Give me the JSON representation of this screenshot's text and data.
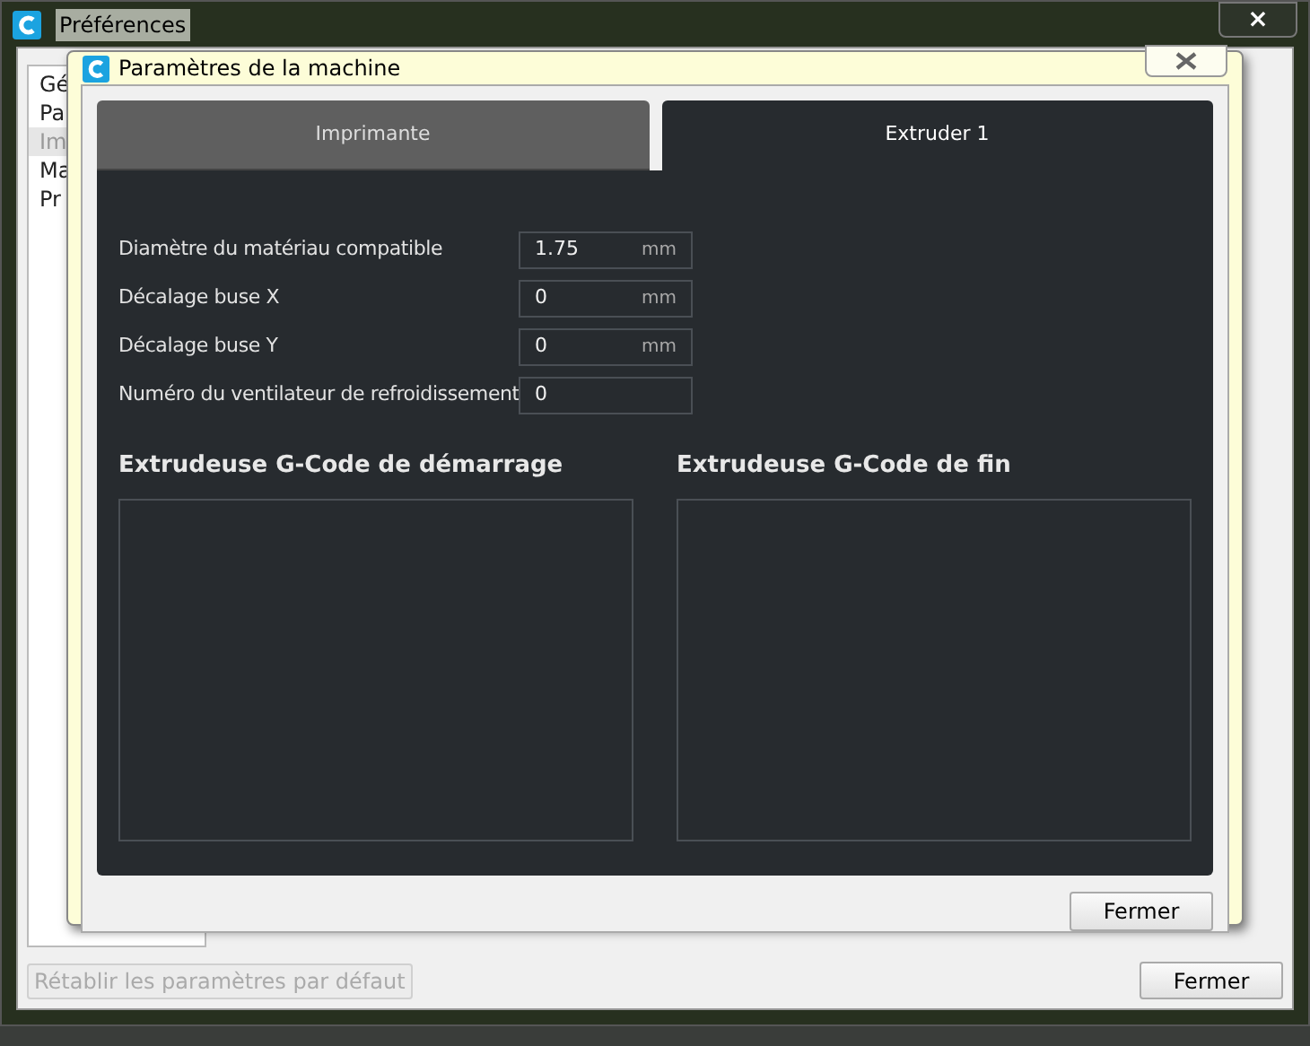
{
  "window": {
    "title": "Préférences",
    "close": "×"
  },
  "sidebar": {
    "items": [
      {
        "label": "Gé",
        "selected": false
      },
      {
        "label": "Pa",
        "selected": false
      },
      {
        "label": "Im",
        "selected": true
      },
      {
        "label": "Ma",
        "selected": false
      },
      {
        "label": "Pr",
        "selected": false
      }
    ]
  },
  "footer": {
    "reset": {
      "label": "Rétablir les paramètres par défaut",
      "disabled": true
    },
    "close": "Fermer"
  },
  "dialog": {
    "title": "Paramètres de la machine",
    "tabs": [
      {
        "label": "Imprimante",
        "selected": false
      },
      {
        "label": "Extruder 1",
        "selected": true
      }
    ],
    "fields": [
      {
        "label": "Diamètre du matériau compatible",
        "value": "1.75",
        "unit": "mm"
      },
      {
        "label": "Décalage buse X",
        "value": "0",
        "unit": "mm"
      },
      {
        "label": "Décalage buse Y",
        "value": "0",
        "unit": "mm"
      },
      {
        "label": "Numéro du ventilateur de refroidissement",
        "value": "0"
      }
    ],
    "gcode": [
      {
        "title": "Extrudeuse G-Code de démarrage"
      },
      {
        "title": "Extrudeuse G-Code de fin"
      }
    ],
    "close": "Fermer"
  }
}
